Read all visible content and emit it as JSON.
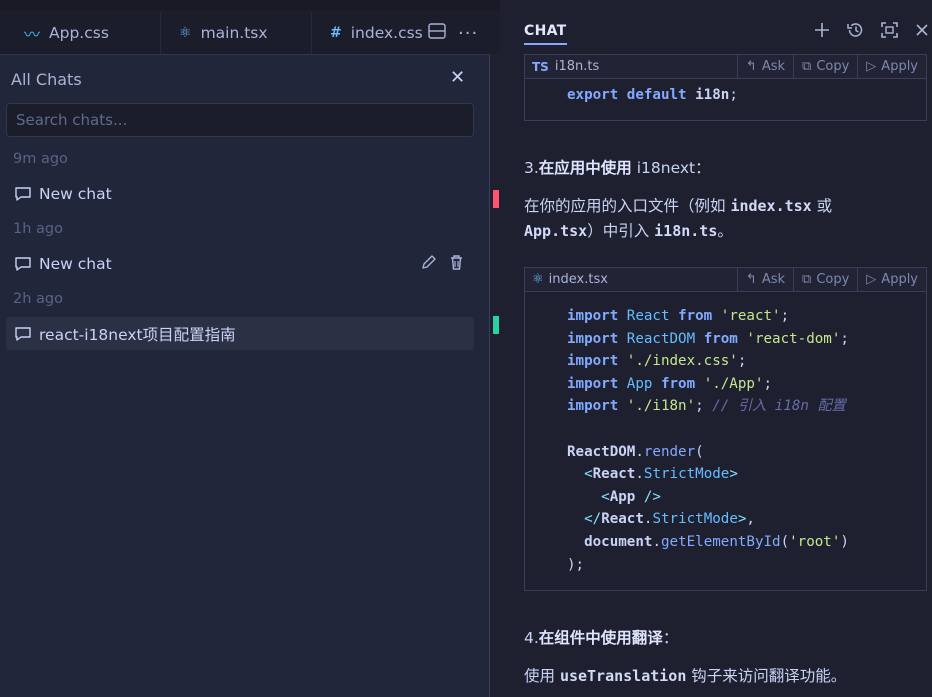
{
  "tabs": [
    {
      "icon": "tailwind-icon",
      "label": "App.css"
    },
    {
      "icon": "react-icon",
      "label": "main.tsx"
    },
    {
      "icon": "hash-icon",
      "label": "index.css"
    }
  ],
  "chats_panel": {
    "title": "All Chats",
    "search_placeholder": "Search chats...",
    "groups": [
      {
        "time": "9m ago",
        "item": "New chat"
      },
      {
        "time": "1h ago",
        "item": "New chat"
      },
      {
        "time": "2h ago",
        "item": "react-i18next项目配置指南"
      }
    ]
  },
  "chat_pane": {
    "title": "CHAT",
    "code_block_1": {
      "lang": "TS",
      "filename": "i18n.ts",
      "actions": [
        "Ask",
        "Copy",
        "Apply"
      ],
      "line": "export default i18n;"
    },
    "step3_num": "3.",
    "step3_title": "在应用中使用",
    "step3_lib": " i18next",
    "step3_colon": "：",
    "para1_a": "在你的应用的入口文件（例如 ",
    "para1_code1": "index.tsx",
    "para1_b": " 或",
    "para1_code2": "App.tsx",
    "para1_c": "）中引入 ",
    "para1_code3": "i18n.ts",
    "para1_d": "。",
    "code_block_2": {
      "filename": "index.tsx",
      "actions": [
        "Ask",
        "Copy",
        "Apply"
      ]
    },
    "step4_num": "4.",
    "step4_title": "在组件中使用翻译",
    "step4_colon": "：",
    "para2_a": "使用 ",
    "para2_code": "useTranslation",
    "para2_b": " 钩子来访问翻译功能。"
  },
  "colors": {
    "accent": "#82aaff",
    "marker_red": "#ff5370",
    "marker_green": "#2bd19f"
  }
}
